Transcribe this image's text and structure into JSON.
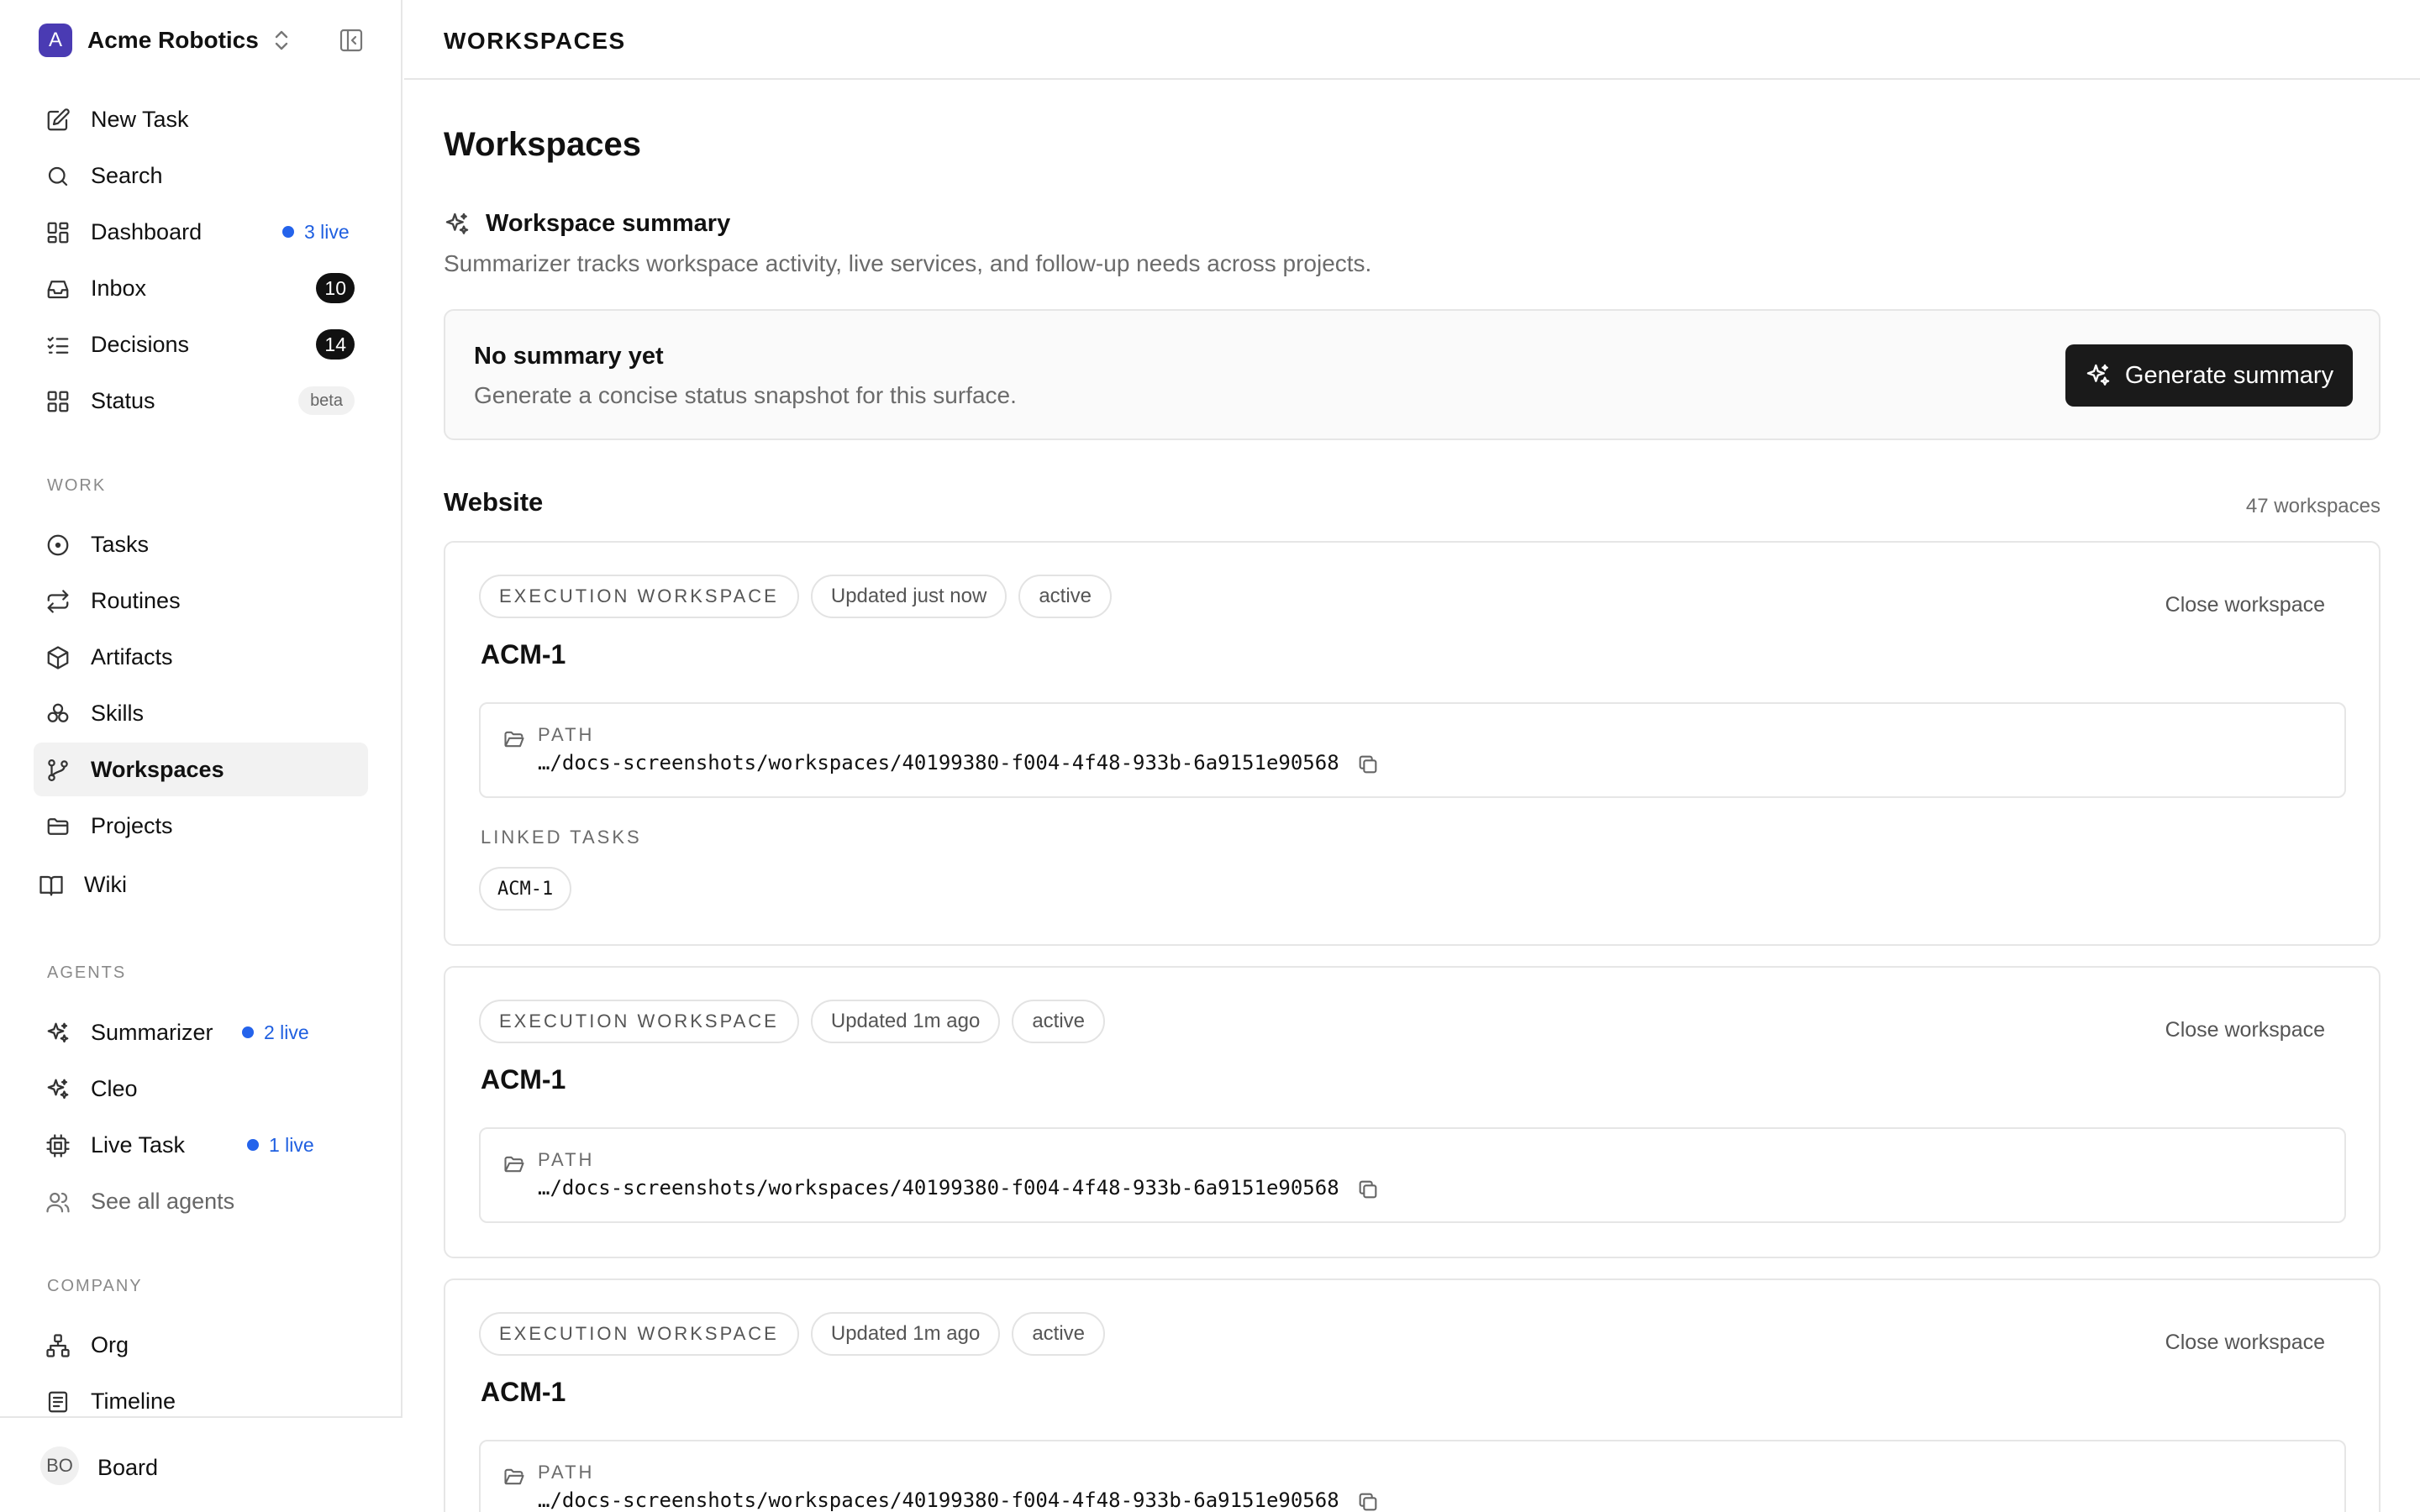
{
  "sidebar": {
    "org": {
      "initial": "A",
      "name": "Acme Robotics"
    },
    "nav": [
      {
        "label": "New Task",
        "icon": "pencil-square-icon"
      },
      {
        "label": "Search",
        "icon": "search-icon"
      },
      {
        "label": "Dashboard",
        "icon": "dashboard-icon",
        "live": "3 live"
      },
      {
        "label": "Inbox",
        "icon": "inbox-icon",
        "count": "10"
      },
      {
        "label": "Decisions",
        "icon": "list-check-icon",
        "count": "14"
      },
      {
        "label": "Status",
        "icon": "grid-icon",
        "tag": "beta"
      }
    ],
    "work_label": "WORK",
    "work": [
      {
        "label": "Tasks",
        "icon": "circle-dot-icon"
      },
      {
        "label": "Routines",
        "icon": "repeat-icon"
      },
      {
        "label": "Artifacts",
        "icon": "box-icon"
      },
      {
        "label": "Skills",
        "icon": "skills-icon"
      },
      {
        "label": "Workspaces",
        "icon": "git-branch-icon",
        "active": true
      },
      {
        "label": "Projects",
        "icon": "folder-icon"
      },
      {
        "label": "Wiki",
        "icon": "book-icon"
      }
    ],
    "agents_label": "AGENTS",
    "agents": [
      {
        "label": "Summarizer",
        "icon": "sparkles-icon",
        "live": "2 live"
      },
      {
        "label": "Cleo",
        "icon": "sparkles-icon"
      },
      {
        "label": "Live Task",
        "icon": "cpu-icon",
        "live": "1 live"
      },
      {
        "label": "See all agents",
        "icon": "users-icon"
      }
    ],
    "company_label": "COMPANY",
    "company": [
      {
        "label": "Org",
        "icon": "org-chart-icon"
      },
      {
        "label": "Timeline",
        "icon": "document-icon"
      }
    ],
    "footer": {
      "initials": "BO",
      "name": "Board"
    }
  },
  "topbar": {
    "title": "WORKSPACES"
  },
  "page": {
    "title": "Workspaces"
  },
  "summary": {
    "title": "Workspace summary",
    "description": "Summarizer tracks workspace activity, live services, and follow-up needs across projects.",
    "card_title": "No summary yet",
    "card_subtitle": "Generate a concise status snapshot for this surface.",
    "button_label": "Generate summary"
  },
  "group": {
    "title": "Website",
    "count": "47 workspaces"
  },
  "workspaces": [
    {
      "kind": "EXECUTION WORKSPACE",
      "updated": "Updated just now",
      "status": "active",
      "close_label": "Close workspace",
      "title": "ACM-1",
      "path_label": "PATH",
      "path": "…/docs-screenshots/workspaces/40199380-f004-4f48-933b-6a9151e90568",
      "linked_label": "LINKED TASKS",
      "linked_tasks": [
        "ACM-1"
      ]
    },
    {
      "kind": "EXECUTION WORKSPACE",
      "updated": "Updated 1m ago",
      "status": "active",
      "close_label": "Close workspace",
      "title": "ACM-1",
      "path_label": "PATH",
      "path": "…/docs-screenshots/workspaces/40199380-f004-4f48-933b-6a9151e90568"
    },
    {
      "kind": "EXECUTION WORKSPACE",
      "updated": "Updated 1m ago",
      "status": "active",
      "close_label": "Close workspace",
      "title": "ACM-1",
      "path_label": "PATH",
      "path": "…/docs-screenshots/workspaces/40199380-f004-4f48-933b-6a9151e90568"
    }
  ],
  "colors": {
    "accent_live": "#2463eb",
    "org_avatar": "#4a3bb3",
    "primary_button": "#1a1a1a",
    "active_nav_bg": "#f2f2f2"
  }
}
